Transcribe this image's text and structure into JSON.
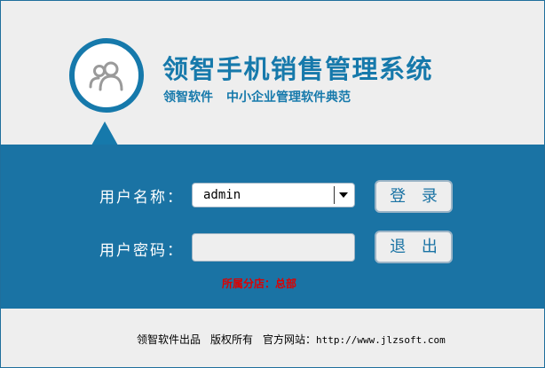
{
  "header": {
    "title": "领智手机销售管理系统",
    "subtitle_brand": "领智软件",
    "subtitle_slogan": "中小企业管理软件典范"
  },
  "form": {
    "username_label": "用户名称：",
    "username_value": "admin",
    "password_label": "用户密码：",
    "password_value": "",
    "login_button": "登 录",
    "exit_button": "退 出",
    "hint": "所属分店：总部"
  },
  "footer": {
    "product": "领智软件出品",
    "rights": "版权所有",
    "site_label": "官方网站：",
    "site_url": "http://www.jlzsoft.com"
  },
  "colors": {
    "brand_blue": "#1a73a4",
    "background": "#eeeeee",
    "hint_red": "#dd0000"
  },
  "icons": {
    "logo": "users-icon",
    "dropdown": "chevron-down-icon"
  }
}
